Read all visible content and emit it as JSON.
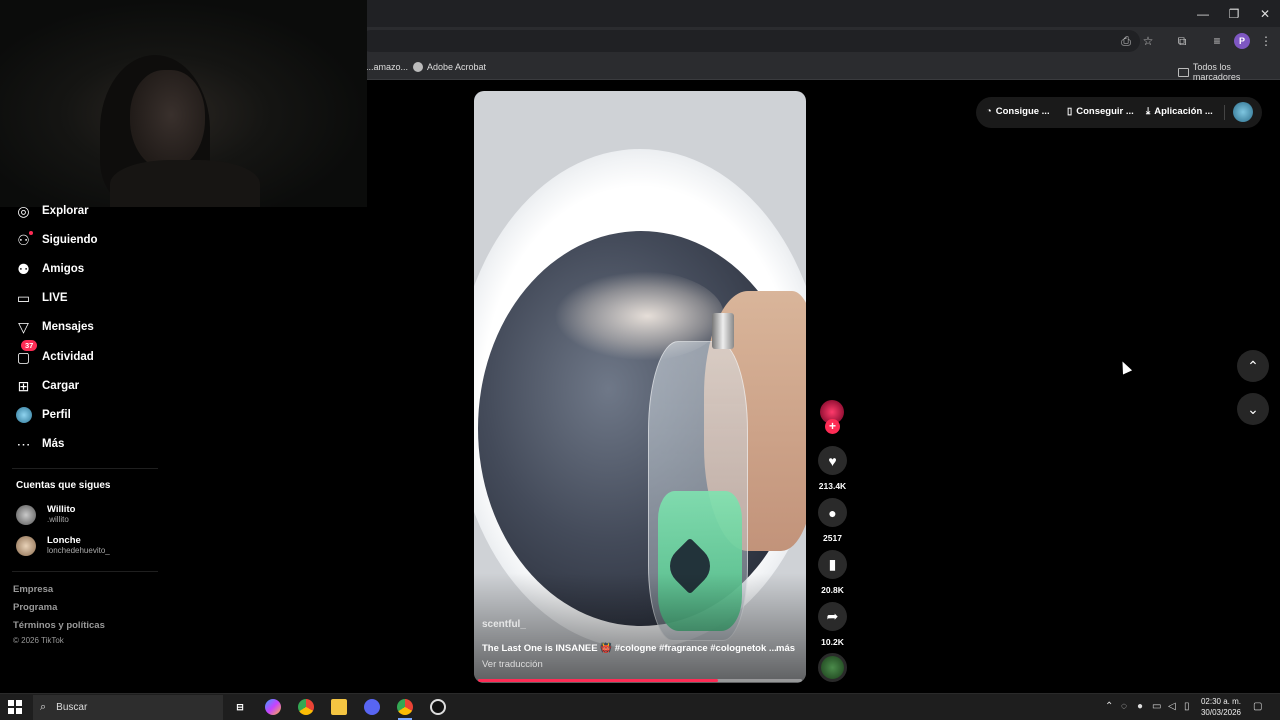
{
  "browser": {
    "window_controls": [
      "minimize",
      "restore",
      "close"
    ],
    "bookmarks": [
      {
        "label": "...amazo...",
        "icon": "site-icon"
      },
      {
        "label": "Adobe Acrobat",
        "icon": "acrobat-icon"
      }
    ],
    "all_bookmarks_label": "Todos los marcadores",
    "profile_initial": "P"
  },
  "sidebar": {
    "items": [
      {
        "label": "Explorar",
        "icon": "compass-icon"
      },
      {
        "label": "Siguiendo",
        "icon": "following-icon"
      },
      {
        "label": "Amigos",
        "icon": "friends-icon"
      },
      {
        "label": "LIVE",
        "icon": "live-icon"
      },
      {
        "label": "Mensajes",
        "icon": "messages-icon"
      },
      {
        "label": "Actividad",
        "icon": "activity-icon",
        "badge": "37"
      },
      {
        "label": "Cargar",
        "icon": "upload-icon"
      },
      {
        "label": "Perfil",
        "icon": "profile-icon"
      },
      {
        "label": "Más",
        "icon": "more-icon"
      }
    ],
    "following_title": "Cuentas que sigues",
    "following": [
      {
        "name": "Willito",
        "handle": ".willito"
      },
      {
        "name": "Lonche",
        "handle": "lonchedehuevito_"
      }
    ],
    "footer": [
      "Empresa",
      "Programa",
      "Términos y políticas"
    ],
    "copyright": "© 2026 TikTok"
  },
  "video": {
    "author": "scentful_",
    "caption": "The Last One is INSANEE 👹 #cologne #fragrance #colognetok ...",
    "more_label": "más",
    "translate_label": "Ver traducción",
    "progress": 0.74
  },
  "actions": {
    "likes": "213.4K",
    "comments": "2517",
    "saves": "20.8K",
    "shares": "10.2K"
  },
  "topbar": {
    "coins_label": "Consigue ...",
    "get_label": "Conseguir ...",
    "app_label": "Aplicación ..."
  },
  "taskbar": {
    "search_label": "Buscar",
    "time": "02:30 a. m.",
    "date": "30/03/2026"
  },
  "colors": {
    "accent": "#fe2c55",
    "background": "#000000"
  }
}
